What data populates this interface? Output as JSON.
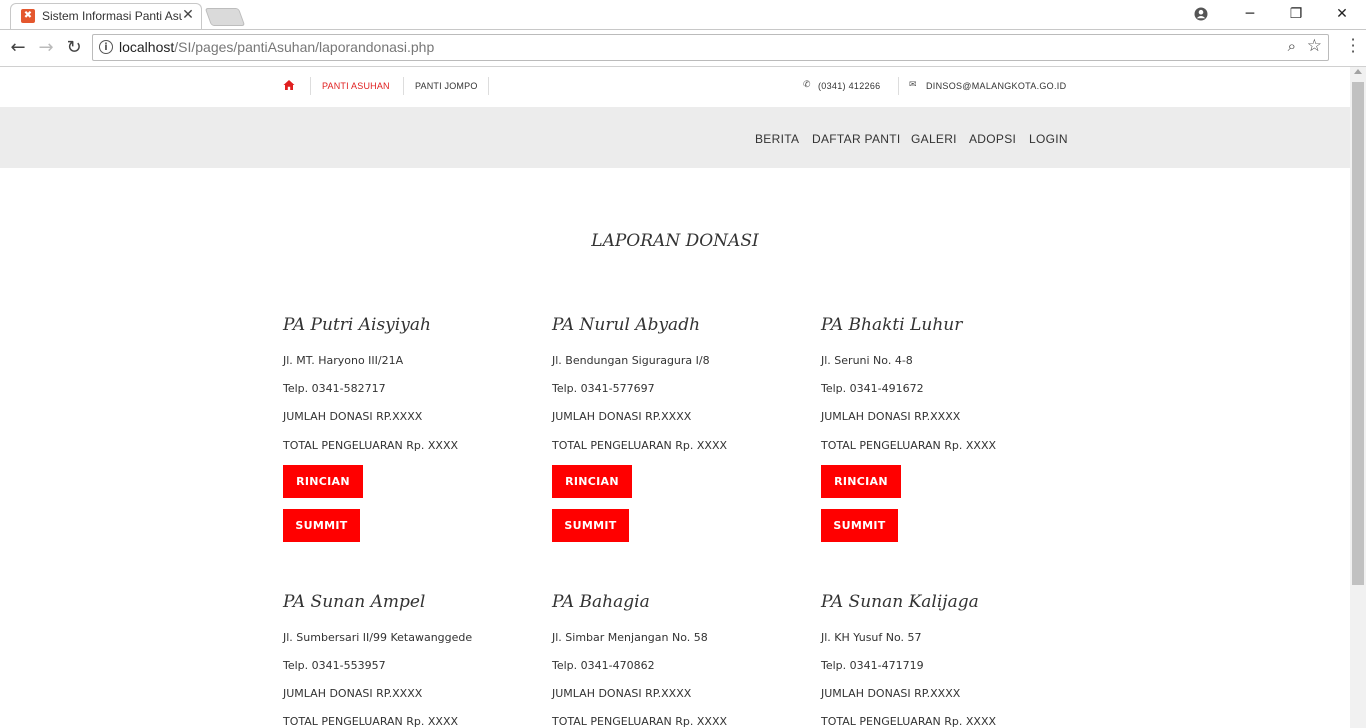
{
  "browser": {
    "tab_title": "Sistem Informasi Panti Asuhan",
    "url_host": "localhost",
    "url_path": "/SI/pages/pantiAsuhan/laporandonasi.php"
  },
  "topbar": {
    "links": [
      "PANTI ASUHAN",
      "PANTI JOMPO"
    ],
    "phone": "(0341) 412266",
    "email": "DINSOS@MALANGKOTA.GO.ID"
  },
  "navbar": {
    "items": [
      "BERITA",
      "DAFTAR PANTI",
      "GALERI",
      "ADOPSI",
      "LOGIN"
    ]
  },
  "page_title": "LAPORAN DONASI",
  "cards": [
    {
      "name": "PA Putri Aisyiyah",
      "address": "Jl. MT. Haryono III/21A",
      "phone": "Telp. 0341-582717",
      "donation": "JUMLAH DONASI RP.XXXX",
      "expense": "TOTAL PENGELUARAN Rp. XXXX",
      "btn_detail": "RINCIAN",
      "btn_submit": "SUMMIT"
    },
    {
      "name": "PA Nurul Abyadh",
      "address": "Jl. Bendungan Siguragura I/8",
      "phone": "Telp. 0341-577697",
      "donation": "JUMLAH DONASI RP.XXXX",
      "expense": "TOTAL PENGELUARAN Rp. XXXX",
      "btn_detail": "RINCIAN",
      "btn_submit": "SUMMIT"
    },
    {
      "name": "PA Bhakti Luhur",
      "address": "Jl. Seruni No. 4-8",
      "phone": "Telp. 0341-491672",
      "donation": "JUMLAH DONASI RP.XXXX",
      "expense": "TOTAL PENGELUARAN Rp. XXXX",
      "btn_detail": "RINCIAN",
      "btn_submit": "SUMMIT"
    },
    {
      "name": "PA Sunan Ampel",
      "address": "Jl. Sumbersari II/99 Ketawanggede",
      "phone": "Telp. 0341-553957",
      "donation": "JUMLAH DONASI RP.XXXX",
      "expense": "TOTAL PENGELUARAN Rp. XXXX"
    },
    {
      "name": "PA Bahagia",
      "address": "Jl. Simbar Menjangan No. 58",
      "phone": "Telp. 0341-470862",
      "donation": "JUMLAH DONASI RP.XXXX",
      "expense": "TOTAL PENGELUARAN Rp. XXXX"
    },
    {
      "name": "PA Sunan Kalijaga",
      "address": "Jl. KH Yusuf No. 57",
      "phone": "Telp. 0341-471719",
      "donation": "JUMLAH DONASI RP.XXXX",
      "expense": "TOTAL PENGELUARAN Rp. XXXX"
    }
  ],
  "colors": {
    "accent": "#ff0000",
    "navbar_bg": "#ececec"
  }
}
